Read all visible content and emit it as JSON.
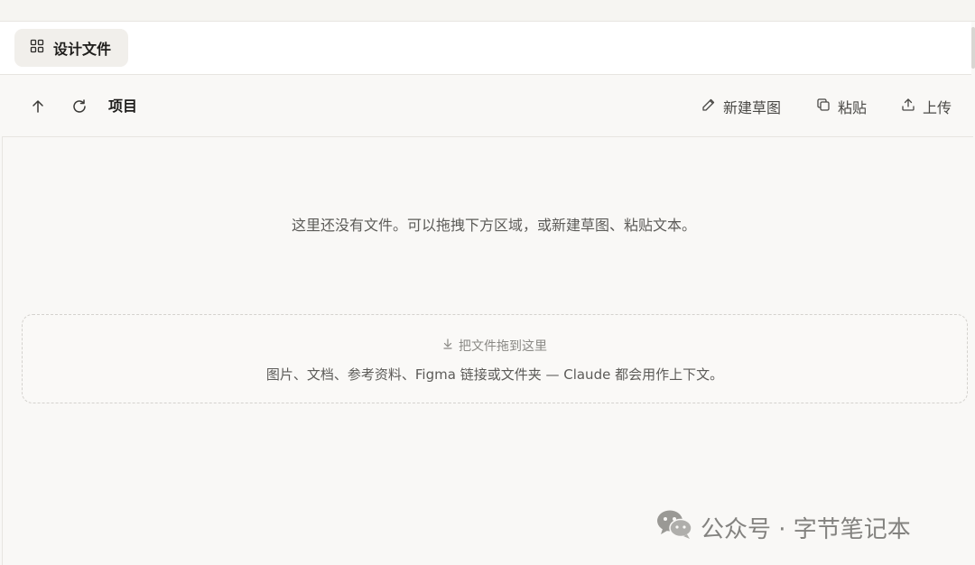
{
  "tab": {
    "label": "设计文件",
    "icon": "grid-icon"
  },
  "toolbar": {
    "up_icon": "arrow-up-icon",
    "refresh_icon": "refresh-icon",
    "breadcrumb": "项目",
    "actions": [
      {
        "label": "新建草图",
        "icon": "pencil-icon"
      },
      {
        "label": "粘贴",
        "icon": "copy-icon"
      },
      {
        "label": "上传",
        "icon": "upload-icon"
      }
    ]
  },
  "main": {
    "empty_message": "这里还没有文件。可以拖拽下方区域，或新建草图、粘贴文本。",
    "dropzone": {
      "title": "把文件拖到这里",
      "title_icon": "arrow-down-icon",
      "subtitle": "图片、文档、参考资料、Figma 链接或文件夹 — Claude 都会用作上下文。"
    }
  },
  "watermark": {
    "text": "公众号 · 字节笔记本",
    "icon": "wechat-icon"
  }
}
